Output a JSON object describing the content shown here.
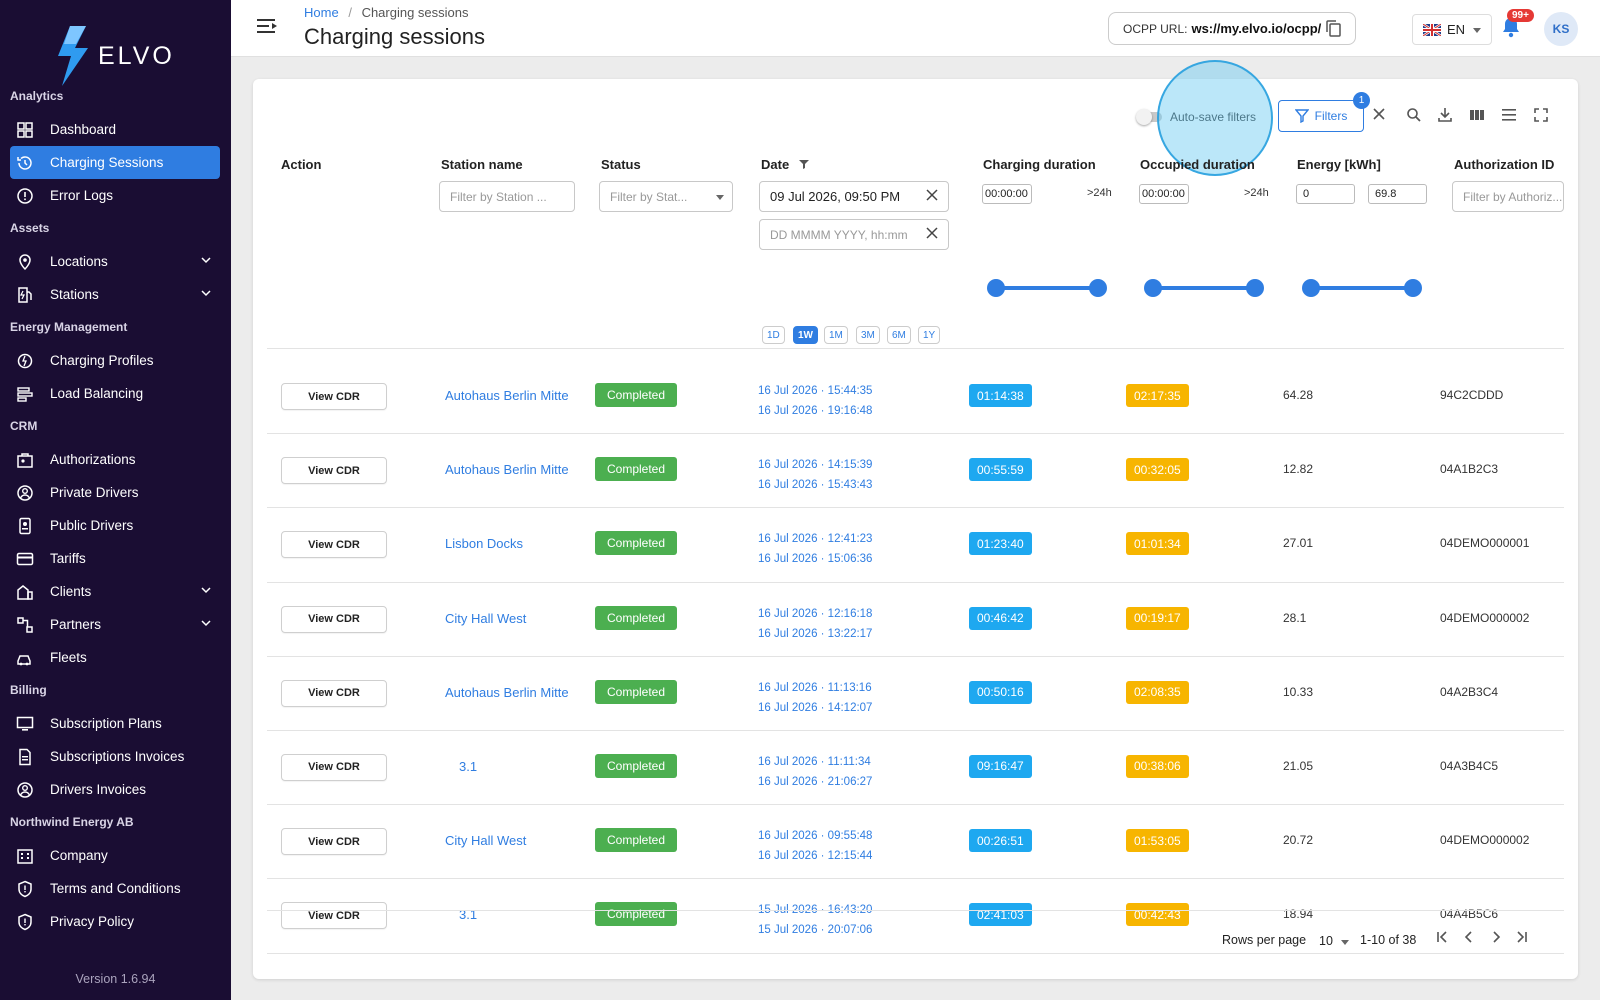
{
  "app": {
    "brand": "ELVO",
    "version": "Version 1.6.94"
  },
  "sidebar": {
    "sections": [
      {
        "title": "Analytics",
        "items": [
          {
            "label": "Dashboard",
            "icon": "dashboard-icon"
          },
          {
            "label": "Charging Sessions",
            "icon": "history-icon",
            "active": true
          },
          {
            "label": "Error Logs",
            "icon": "alert-circle-icon"
          }
        ]
      },
      {
        "title": "Assets",
        "items": [
          {
            "label": "Locations",
            "icon": "location-pin-icon",
            "expandable": true
          },
          {
            "label": "Stations",
            "icon": "ev-station-icon",
            "expandable": true
          }
        ]
      },
      {
        "title": "Energy Management",
        "items": [
          {
            "label": "Charging Profiles",
            "icon": "charging-profile-icon"
          },
          {
            "label": "Load Balancing",
            "icon": "load-balancing-icon"
          }
        ]
      },
      {
        "title": "CRM",
        "items": [
          {
            "label": "Authorizations",
            "icon": "authorization-icon"
          },
          {
            "label": "Private Drivers",
            "icon": "user-circle-icon"
          },
          {
            "label": "Public Drivers",
            "icon": "badge-icon"
          },
          {
            "label": "Tariffs",
            "icon": "credit-card-icon"
          },
          {
            "label": "Clients",
            "icon": "clients-icon",
            "expandable": true
          },
          {
            "label": "Partners",
            "icon": "partners-icon",
            "expandable": true
          },
          {
            "label": "Fleets",
            "icon": "fleet-icon"
          }
        ]
      },
      {
        "title": "Billing",
        "items": [
          {
            "label": "Subscription Plans",
            "icon": "monitor-icon"
          },
          {
            "label": "Subscriptions Invoices",
            "icon": "invoice-icon"
          },
          {
            "label": "Drivers Invoices",
            "icon": "user-circle-icon"
          }
        ]
      },
      {
        "title": "Northwind Energy AB",
        "items": [
          {
            "label": "Company",
            "icon": "building-icon"
          },
          {
            "label": "Terms and Conditions",
            "icon": "shield-icon"
          },
          {
            "label": "Privacy Policy",
            "icon": "shield-icon"
          }
        ]
      }
    ]
  },
  "header": {
    "breadcrumb_home": "Home",
    "breadcrumb_sep": "/",
    "breadcrumb_current": "Charging sessions",
    "title": "Charging sessions",
    "ocpp_label": "OCPP URL:",
    "ocpp_url": "ws://my.elvo.io/ocpp/",
    "language": "EN",
    "notifications": "99+",
    "avatar": "KS"
  },
  "toolbar": {
    "autosave_label": "Auto-save filters",
    "filters_label": "Filters",
    "filters_count": "1"
  },
  "columns": {
    "action": "Action",
    "station": "Station name",
    "status": "Status",
    "date": "Date",
    "charging_duration": "Charging duration",
    "occupied_duration": "Occupied duration",
    "energy": "Energy [kWh]",
    "auth": "Authorization ID"
  },
  "filters": {
    "station_placeholder": "Filter by Station ...",
    "status_placeholder": "Filter by Stat...",
    "date_from": "09 Jul 2026, 09:50 PM",
    "date_to_placeholder": "DD MMMM YYYY, hh:mm",
    "date_chips": [
      "1D",
      "1W",
      "1M",
      "3M",
      "6M",
      "1Y"
    ],
    "date_chip_selected": "1W",
    "charging_min": "00:00:00",
    "charging_max": ">24h",
    "occupied_min": "00:00:00",
    "occupied_max": ">24h",
    "energy_min": "0",
    "energy_max": "69.8",
    "auth_placeholder": "Filter by Authoriz..."
  },
  "rows": [
    {
      "action": "View CDR",
      "station": "Autohaus Berlin Mitte",
      "status": "Completed",
      "start": "16 Jul 2026 · 15:44:35",
      "end": "16 Jul 2026 · 19:16:48",
      "charging": "01:14:38",
      "occupied": "02:17:35",
      "energy": "64.28",
      "auth": "94C2CDDD"
    },
    {
      "action": "View CDR",
      "station": "Autohaus Berlin Mitte",
      "status": "Completed",
      "start": "16 Jul 2026 · 14:15:39",
      "end": "16 Jul 2026 · 15:43:43",
      "charging": "00:55:59",
      "occupied": "00:32:05",
      "energy": "12.82",
      "auth": "04A1B2C3"
    },
    {
      "action": "View CDR",
      "station": "Lisbon Docks",
      "status": "Completed",
      "start": "16 Jul 2026 · 12:41:23",
      "end": "16 Jul 2026 · 15:06:36",
      "charging": "01:23:40",
      "occupied": "01:01:34",
      "energy": "27.01",
      "auth": "04DEMO000001"
    },
    {
      "action": "View CDR",
      "station": "City Hall West",
      "status": "Completed",
      "start": "16 Jul 2026 · 12:16:18",
      "end": "16 Jul 2026 · 13:22:17",
      "charging": "00:46:42",
      "occupied": "00:19:17",
      "energy": "28.1",
      "auth": "04DEMO000002"
    },
    {
      "action": "View CDR",
      "station": "Autohaus Berlin Mitte",
      "status": "Completed",
      "start": "16 Jul 2026 · 11:13:16",
      "end": "16 Jul 2026 · 14:12:07",
      "charging": "00:50:16",
      "occupied": "02:08:35",
      "energy": "10.33",
      "auth": "04A2B3C4"
    },
    {
      "action": "View CDR",
      "station": "3.1",
      "status": "Completed",
      "start": "16 Jul 2026 · 11:11:34",
      "end": "16 Jul 2026 · 21:06:27",
      "charging": "09:16:47",
      "occupied": "00:38:06",
      "energy": "21.05",
      "auth": "04A3B4C5"
    },
    {
      "action": "View CDR",
      "station": "City Hall West",
      "status": "Completed",
      "start": "16 Jul 2026 · 09:55:48",
      "end": "16 Jul 2026 · 12:15:44",
      "charging": "00:26:51",
      "occupied": "01:53:05",
      "energy": "20.72",
      "auth": "04DEMO000002"
    },
    {
      "action": "View CDR",
      "station": "3.1",
      "status": "Completed",
      "start": "15 Jul 2026 · 16:43:20",
      "end": "15 Jul 2026 · 20:07:06",
      "charging": "02:41:03",
      "occupied": "00:42:43",
      "energy": "18.94",
      "auth": "04A4B5C6"
    }
  ],
  "pagination": {
    "rows_per_page_label": "Rows per page",
    "rows_per_page": "10",
    "range": "1-10 of 38"
  },
  "colors": {
    "sidebar_bg": "#1a0d33",
    "accent": "#2f7de1",
    "completed": "#4caf50",
    "charging_badge": "#1ea8f0",
    "occupied_badge": "#f7b500"
  }
}
